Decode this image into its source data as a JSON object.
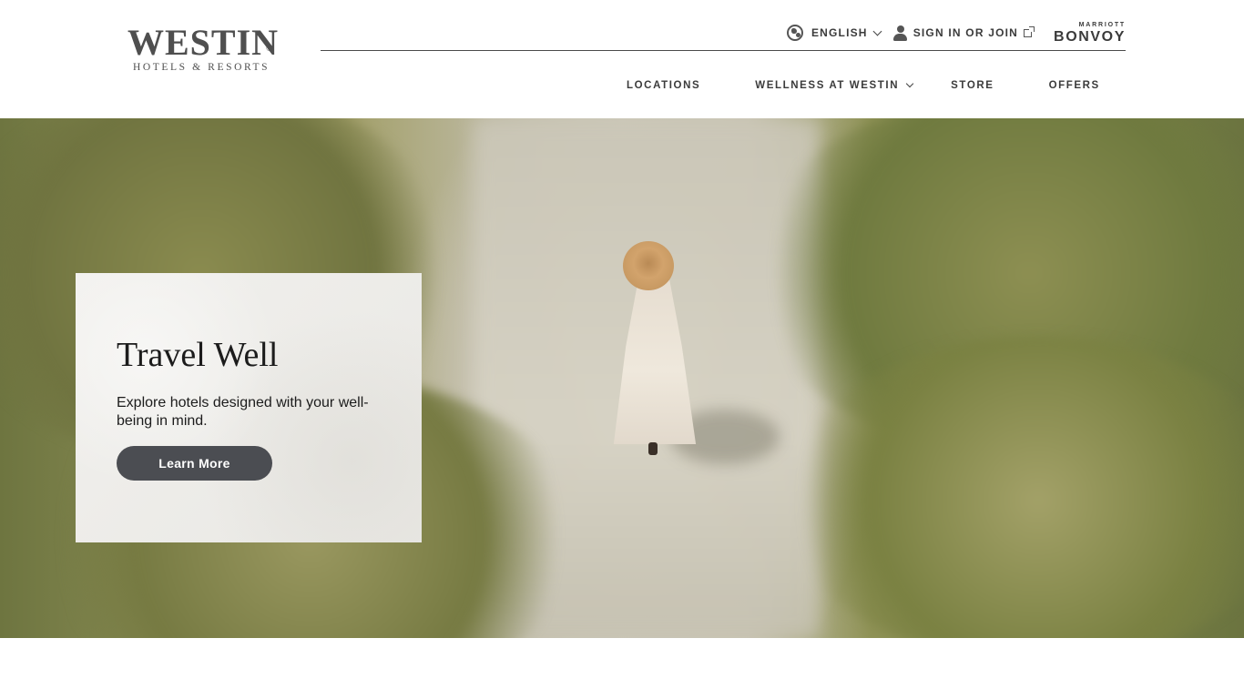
{
  "brand": {
    "logo_main": "WESTIN",
    "logo_registered": "®",
    "logo_sub": "HOTELS & RESORTS"
  },
  "utility": {
    "language": "ENGLISH",
    "sign_in": "SIGN IN OR JOIN",
    "bonvoy_top": "MARRIOTT",
    "bonvoy_main": "BONVOY"
  },
  "nav": {
    "items": [
      {
        "label": "LOCATIONS"
      },
      {
        "label": "WELLNESS AT WESTIN"
      },
      {
        "label": "STORE"
      },
      {
        "label": "OFFERS"
      }
    ]
  },
  "hero": {
    "title": "Travel Well",
    "text": "Explore hotels designed with your well-being in mind.",
    "button": "Learn More"
  },
  "colors": {
    "button_bg": "#4b4d52",
    "text_dark": "#1c1c1c",
    "card_bg": "#efeeeb"
  }
}
